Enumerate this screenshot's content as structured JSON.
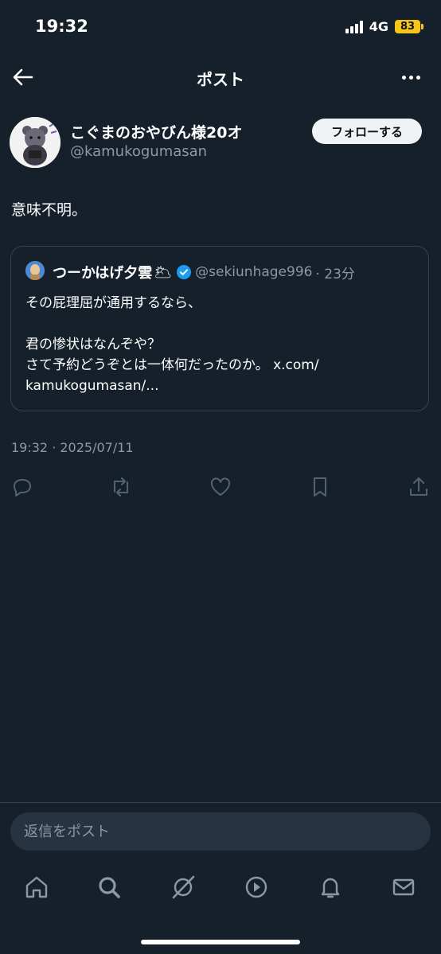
{
  "status_bar": {
    "time": "19:32",
    "network": "4G",
    "battery": "83"
  },
  "header": {
    "title": "ポスト"
  },
  "post": {
    "display_name": "こぐまのおやびん様20オ",
    "handle": "@kamukogumasan",
    "follow_label": "フォローする",
    "text": "意味不明。",
    "timestamp": "19:32 · 2025/07/11"
  },
  "quote": {
    "name": "つーかはげ夕雲",
    "emoji": "🌥",
    "handle": "@sekiunhage996",
    "time_ago": "· 23分",
    "lines": [
      "その屁理屈が通用するなら、",
      "",
      "君の惨状はなんぞや？",
      "さて予約どうぞとは一体何だったのか。 x.com/",
      "kamukogumasan/..."
    ]
  },
  "actions": [
    "reply-icon",
    "repost-icon",
    "like-icon",
    "bookmark-icon",
    "share-icon"
  ],
  "reply_box": {
    "placeholder": "返信をポスト"
  },
  "bottom_nav": [
    "home-icon",
    "search-icon",
    "grok-icon",
    "video-icon",
    "notifications-icon",
    "messages-icon"
  ],
  "colors": {
    "background": "#15202b",
    "border": "#38444d",
    "secondary_text": "#8b98a5",
    "verified": "#1d9bf0"
  }
}
